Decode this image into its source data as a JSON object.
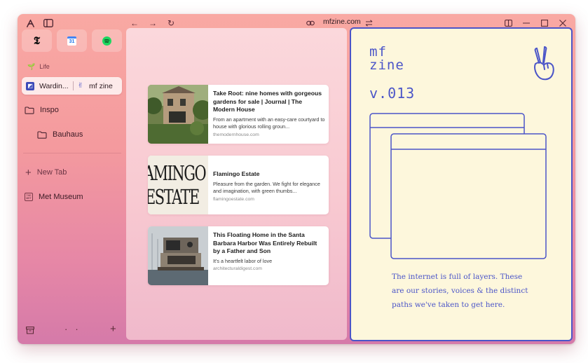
{
  "sidebar": {
    "space_label": "Life",
    "active_tab": {
      "left": "Wardin...",
      "right": "mf zine"
    },
    "items": [
      {
        "label": "Inspo"
      },
      {
        "label": "Bauhaus"
      },
      {
        "label": "New Tab"
      },
      {
        "label": "Met Museum"
      }
    ],
    "favorites": [
      "new-york-times",
      "google-calendar",
      "spotify"
    ],
    "calendar_day": "31",
    "met_icon_text": "THE MET"
  },
  "toolbar": {
    "url": "mfzine.com"
  },
  "cards": [
    {
      "title": "Take Root: nine homes with gorgeous gardens for sale | Journal | The Modern House",
      "desc": "From an apartment with an easy-care courtyard to house with glorious rolling groun...",
      "source": "themodernhouse.com"
    },
    {
      "title": "Flamingo Estate",
      "desc": "Pleasure from the garden. We fight for elegance and imagination, with green thumbs...",
      "source": "flamingoestate.com",
      "thumb_text": [
        "AMINGO",
        "ESTATE"
      ]
    },
    {
      "title": "This Floating Home in the Santa Barbara Harbor Was Entirely Rebuilt by a Father and Son",
      "desc": "It's a heartfelt labor of love",
      "source": "architecturaldigest.com"
    }
  ],
  "zine": {
    "title_line1": "mf",
    "title_line2": "zine",
    "version": "v.013",
    "copy": "The internet is full of layers. These are our stories, voices & the distinct paths we've taken to get here."
  },
  "colors": {
    "zine_blue": "#4b55c8",
    "zine_bg": "#fdf7dc",
    "window_gradient_top": "#f9a9a3",
    "window_gradient_bottom": "#d57aa9"
  }
}
